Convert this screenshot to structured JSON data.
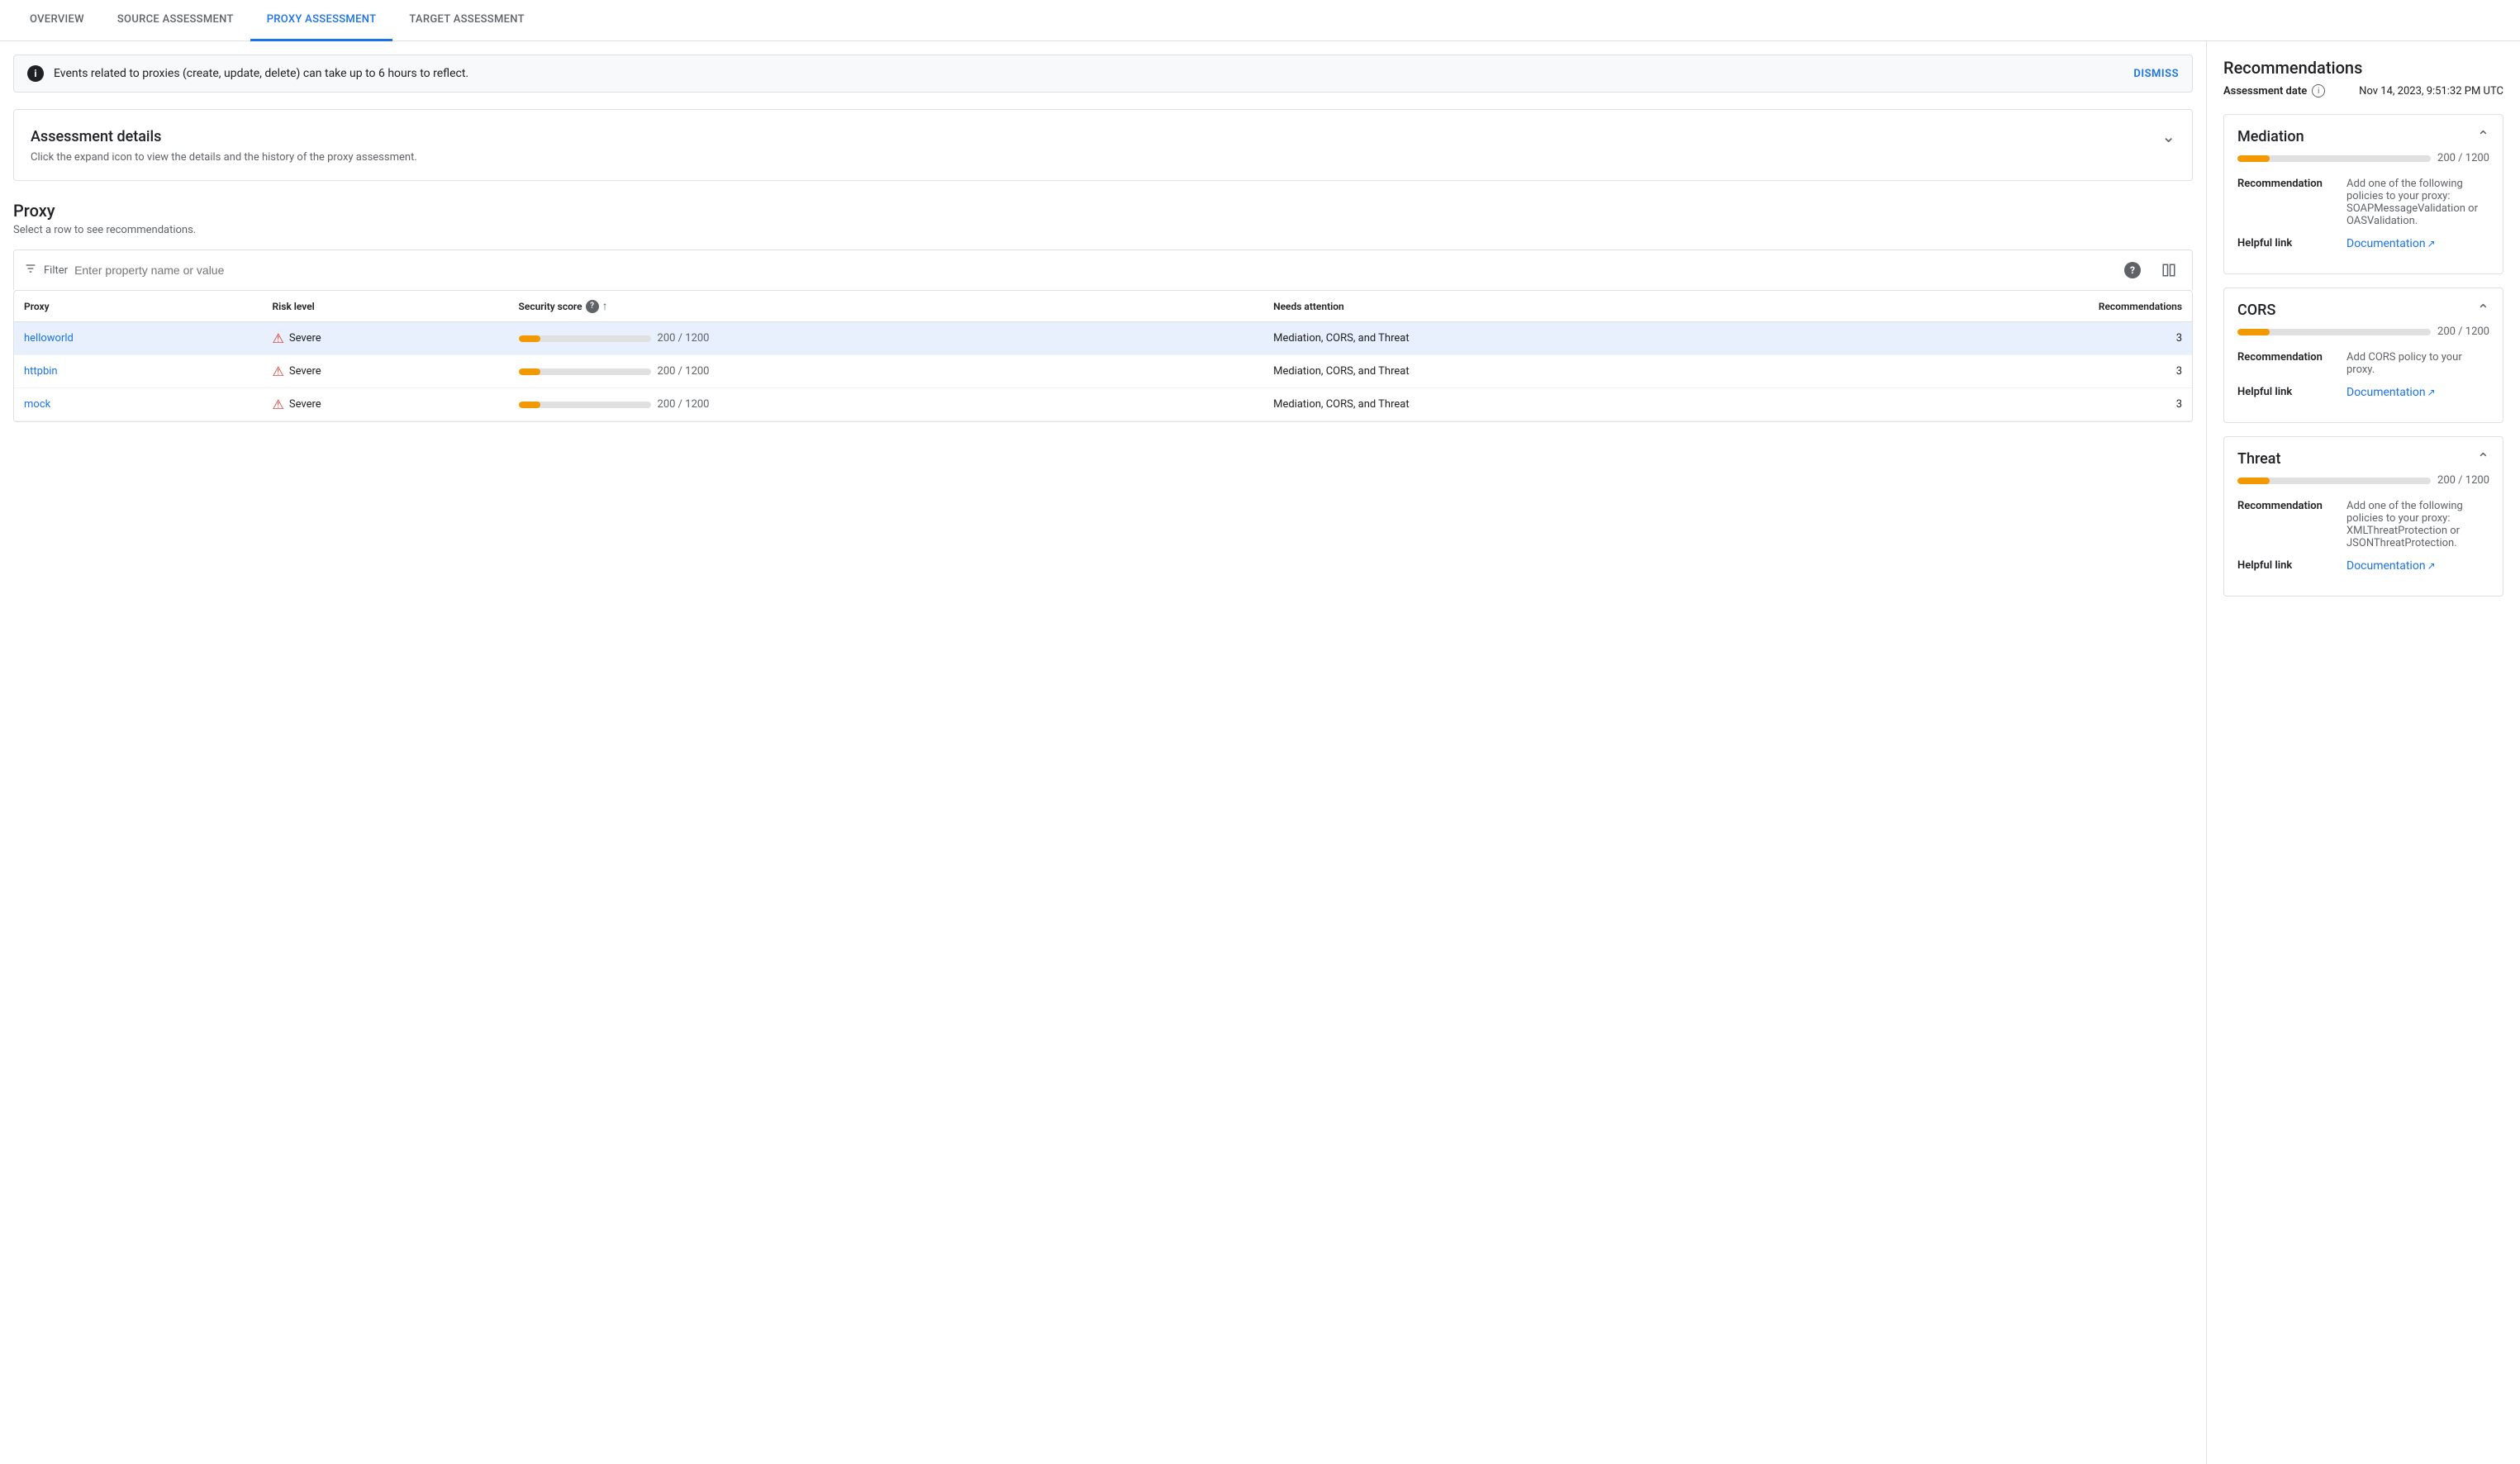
{
  "tabs": [
    {
      "id": "overview",
      "label": "OVERVIEW",
      "active": false
    },
    {
      "id": "source",
      "label": "SOURCE ASSESSMENT",
      "active": false
    },
    {
      "id": "proxy",
      "label": "PROXY ASSESSMENT",
      "active": true
    },
    {
      "id": "target",
      "label": "TARGET ASSESSMENT",
      "active": false
    }
  ],
  "banner": {
    "text": "Events related to proxies (create, update, delete) can take up to 6 hours to reflect.",
    "dismiss_label": "DISMISS"
  },
  "assessment_details": {
    "title": "Assessment details",
    "subtitle": "Click the expand icon to view the details and the history of the proxy assessment."
  },
  "proxy_section": {
    "title": "Proxy",
    "subtitle": "Select a row to see recommendations.",
    "filter_placeholder": "Enter property name or value",
    "table": {
      "columns": [
        {
          "id": "proxy",
          "label": "Proxy"
        },
        {
          "id": "risk_level",
          "label": "Risk level"
        },
        {
          "id": "security_score",
          "label": "Security score"
        },
        {
          "id": "needs_attention",
          "label": "Needs attention"
        },
        {
          "id": "recommendations",
          "label": "Recommendations"
        }
      ],
      "rows": [
        {
          "proxy": "helloworld",
          "risk_level": "Severe",
          "score_value": 200,
          "score_max": 1200,
          "score_display": "200 / 1200",
          "score_percent": 16.7,
          "needs_attention": "Mediation, CORS, and Threat",
          "recommendations": "3",
          "selected": true
        },
        {
          "proxy": "httpbin",
          "risk_level": "Severe",
          "score_value": 200,
          "score_max": 1200,
          "score_display": "200 / 1200",
          "score_percent": 16.7,
          "needs_attention": "Mediation, CORS, and Threat",
          "recommendations": "3",
          "selected": false
        },
        {
          "proxy": "mock",
          "risk_level": "Severe",
          "score_value": 200,
          "score_max": 1200,
          "score_display": "200 / 1200",
          "score_percent": 16.7,
          "needs_attention": "Mediation, CORS, and Threat",
          "recommendations": "3",
          "selected": false
        }
      ]
    }
  },
  "right_panel": {
    "title": "Recommendations",
    "assessment_date_label": "Assessment date",
    "assessment_date_value": "Nov 14, 2023, 9:51:32 PM UTC",
    "cards": [
      {
        "id": "mediation",
        "title": "Mediation",
        "score_display": "200 / 1200",
        "score_percent": 16.7,
        "recommendation_label": "Recommendation",
        "recommendation_text": "Add one of the following policies to your proxy: SOAPMessageValidation or OASValidation.",
        "helpful_link_label": "Helpful link",
        "helpful_link_text": "Documentation",
        "helpful_link_url": "#"
      },
      {
        "id": "cors",
        "title": "CORS",
        "score_display": "200 / 1200",
        "score_percent": 16.7,
        "recommendation_label": "Recommendation",
        "recommendation_text": "Add CORS policy to your proxy.",
        "helpful_link_label": "Helpful link",
        "helpful_link_text": "Documentation",
        "helpful_link_url": "#"
      },
      {
        "id": "threat",
        "title": "Threat",
        "score_display": "200 / 1200",
        "score_percent": 16.7,
        "recommendation_label": "Recommendation",
        "recommendation_text": "Add one of the following policies to your proxy: XMLThreatProtection or JSONThreatProtection.",
        "helpful_link_label": "Helpful link",
        "helpful_link_text": "Documentation",
        "helpful_link_url": "#"
      }
    ]
  }
}
